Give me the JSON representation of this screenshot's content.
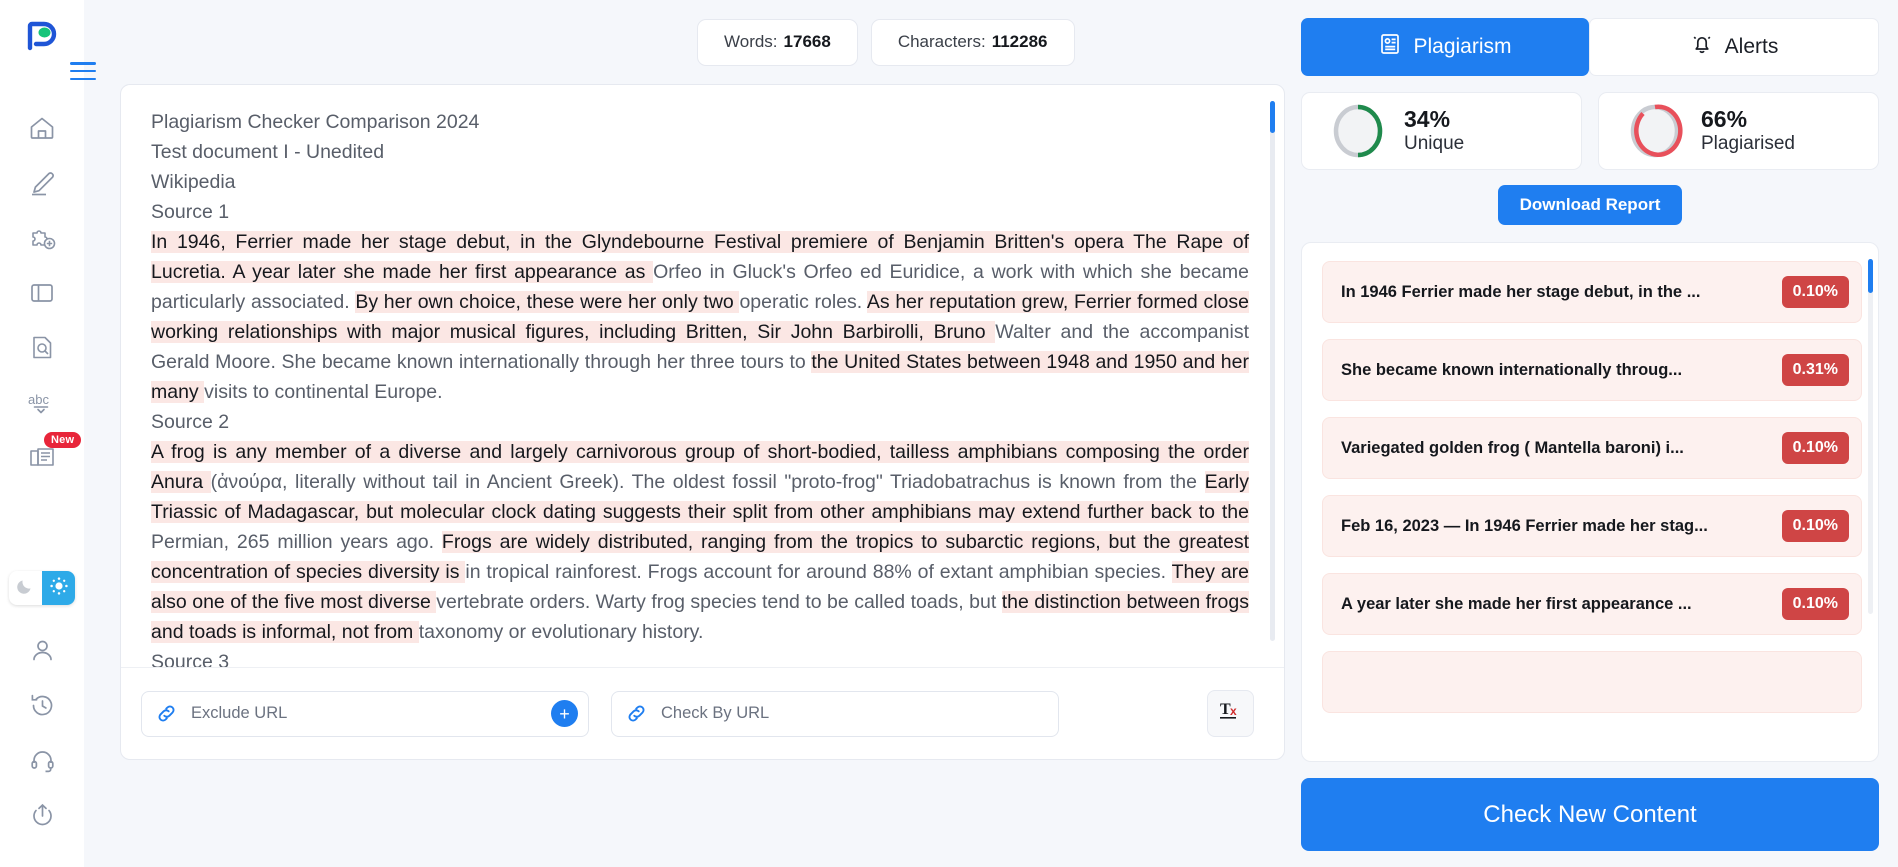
{
  "sidebar": {
    "logo_alt": "prepostseo-logo",
    "items": [
      {
        "name": "home",
        "icon": "home-icon"
      },
      {
        "name": "paraphrase",
        "icon": "pencil-icon"
      },
      {
        "name": "plugin",
        "icon": "puzzle-plus-icon"
      },
      {
        "name": "panel",
        "icon": "panel-icon"
      },
      {
        "name": "image-search",
        "icon": "image-search-icon"
      },
      {
        "name": "grammar",
        "icon": "abc-check-icon"
      },
      {
        "name": "articles",
        "icon": "article-stack-icon",
        "badge": "New"
      }
    ],
    "theme": {
      "dark_icon": "moon-icon",
      "light_icon": "sun-icon",
      "active": "light"
    },
    "bottom_items": [
      {
        "name": "account",
        "icon": "user-icon"
      },
      {
        "name": "history",
        "icon": "clock-history-icon"
      },
      {
        "name": "support",
        "icon": "headset-icon"
      },
      {
        "name": "upload",
        "icon": "upload-icon"
      }
    ]
  },
  "counters": {
    "words_label": "Words:",
    "words_value": "17668",
    "characters_label": "Characters:",
    "characters_value": "112286"
  },
  "editor": {
    "lines": [
      {
        "type": "plain",
        "text": "Plagiarism Checker Comparison 2024"
      },
      {
        "type": "plain",
        "text": "Test document I - Unedited"
      },
      {
        "type": "plain",
        "text": "Wikipedia"
      },
      {
        "type": "plain",
        "text": "Source 1"
      }
    ],
    "paragraph1": [
      {
        "hl": true,
        "t": "In 1946, Ferrier made her stage debut, in the Glyndebourne "
      },
      {
        "hl": true,
        "t": "Festival premiere of Benjamin Britten's opera The Rape of Lucretia. "
      },
      {
        "hl": true,
        "t": "A year later she made her first appearance as "
      },
      {
        "hl": false,
        "t": "Orfeo in Gluck's Orfeo ed Euridice, a work with which she became particularly associated. "
      },
      {
        "hl": true,
        "t": "By her own choice, these were her only two "
      },
      {
        "hl": false,
        "t": "operatic roles. "
      },
      {
        "hl": true,
        "t": "As her reputation grew, Ferrier formed close working relationships "
      },
      {
        "hl": true,
        "t": "with major musical figures, including Britten, Sir John Barbirolli, Bruno "
      },
      {
        "hl": false,
        "t": "Walter and the accompanist Gerald Moore. She became known internationally through her three tours to "
      },
      {
        "hl": true,
        "t": "the United States between 1948 and 1950 and her many "
      },
      {
        "hl": false,
        "t": "visits to continental Europe."
      }
    ],
    "source2_label": "Source 2",
    "paragraph2": [
      {
        "hl": true,
        "t": "A frog is any member of a diverse and largely "
      },
      {
        "hl": true,
        "t": "carnivorous group of short-bodied, tailless amphibians composing the order Anura "
      },
      {
        "hl": false,
        "t": "(ἀνούρα, literally without tail in Ancient Greek). The oldest fossil \"proto-frog\" Triadobatrachus is known from the "
      },
      {
        "hl": true,
        "t": "Early Triassic of Madagascar, but molecular clock dating suggests their split from other amphibians may extend further back to the "
      },
      {
        "hl": false,
        "t": "Permian, 265 million years ago. "
      },
      {
        "hl": true,
        "t": "Frogs are widely distributed, ranging from the tropics to subarctic regions, but the greatest concentration of species diversity is "
      },
      {
        "hl": false,
        "t": "in tropical rainforest. Frogs account for around 88% of extant amphibian species. "
      },
      {
        "hl": true,
        "t": "They are also one of the five most diverse "
      },
      {
        "hl": false,
        "t": "vertebrate orders. Warty frog species tend to be called toads, but "
      },
      {
        "hl": true,
        "t": "the distinction between frogs and toads is informal, not from "
      },
      {
        "hl": false,
        "t": "taxonomy or evolutionary history."
      }
    ],
    "source3_label": "Source 3"
  },
  "footer": {
    "exclude_url_placeholder": "Exclude URL",
    "exclude_url_value": "",
    "check_by_url_placeholder": "Check By URL",
    "check_by_url_value": "",
    "add_label": "+",
    "clear_text_icon": "clear-formatting-icon"
  },
  "rightPanel": {
    "tabs": [
      {
        "label": "Plagiarism",
        "icon": "plagiarism-icon",
        "active": true
      },
      {
        "label": "Alerts",
        "icon": "bell-icon",
        "active": false
      }
    ],
    "gauges": [
      {
        "pct": "34%",
        "caption": "Unique",
        "color": "#1f8a4c",
        "value": 34
      },
      {
        "pct": "66%",
        "caption": "Plagiarised",
        "color": "#e8505b",
        "value": 66
      }
    ],
    "download_label": "Download Report",
    "results": [
      {
        "title": "In 1946 Ferrier made her stage debut, in the ...",
        "pct": "0.10%"
      },
      {
        "title": "She became known internationally throug...",
        "pct": "0.31%"
      },
      {
        "title": "Variegated golden frog ( Mantella baroni) i...",
        "pct": "0.10%"
      },
      {
        "title": "Feb 16, 2023 — In 1946 Ferrier made her stag...",
        "pct": "0.10%"
      },
      {
        "title": "A year later she made her first appearance ...",
        "pct": "0.10%"
      }
    ],
    "check_button_label": "Check New Content"
  },
  "colors": {
    "accent": "#1f7ef0",
    "highlight": "#fbe7e4",
    "danger": "#cf4545",
    "unique": "#1f8a4c",
    "plagiarised": "#e8505b"
  }
}
